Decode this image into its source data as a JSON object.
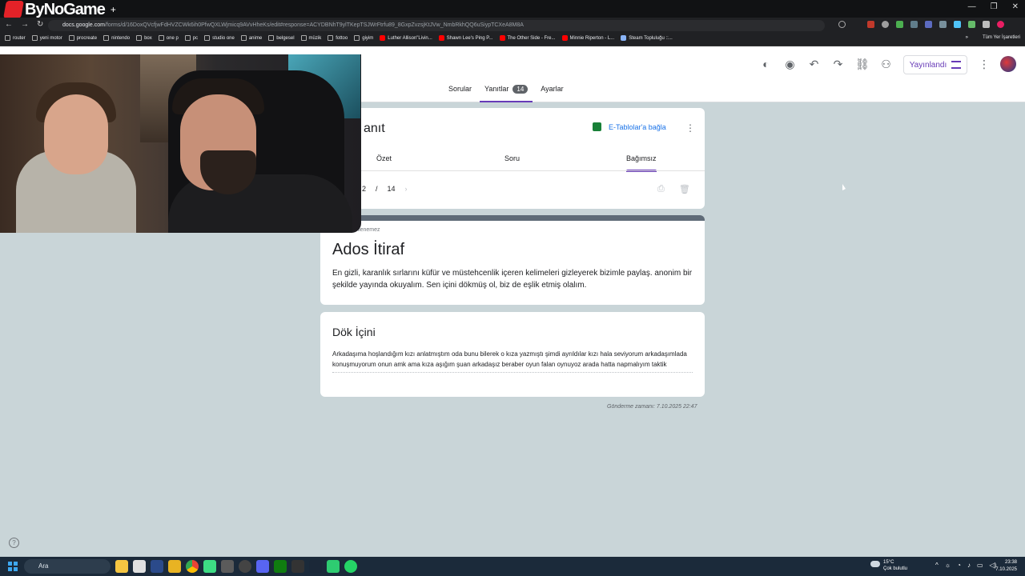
{
  "brand": {
    "logo_text": "ByNoGame"
  },
  "browser": {
    "url_host": "docs.google.com",
    "url_path": "/forms/d/16DoxQVcfjwFdHVZCWk6ih0PfwQXLWjmicq9AVvHheKs/edit#response=ACYDBNhT9ylTKepTSJWrFtrfu89_8GxpZvzsjKtJVw_NmbRkhQQ6uSiypTCXeA8M8A",
    "bookmarks": [
      {
        "label": "router",
        "kind": "folder"
      },
      {
        "label": "yeni motor",
        "kind": "folder"
      },
      {
        "label": "procreate",
        "kind": "folder"
      },
      {
        "label": "nintendo",
        "kind": "folder"
      },
      {
        "label": "box",
        "kind": "folder"
      },
      {
        "label": "one p",
        "kind": "folder"
      },
      {
        "label": "pc",
        "kind": "folder"
      },
      {
        "label": "studio one",
        "kind": "folder"
      },
      {
        "label": "anime",
        "kind": "folder"
      },
      {
        "label": "belgesel",
        "kind": "folder"
      },
      {
        "label": "müzik",
        "kind": "folder"
      },
      {
        "label": "fottoo",
        "kind": "folder"
      },
      {
        "label": "giyim",
        "kind": "folder"
      },
      {
        "label": "Luther Allison\"Livin...",
        "kind": "yt"
      },
      {
        "label": "Shawn Lee's Ping P...",
        "kind": "yt"
      },
      {
        "label": "The Other Side - Fre...",
        "kind": "yt"
      },
      {
        "label": "Minnie Riperton - L...",
        "kind": "yt"
      },
      {
        "label": "Steam Topluluğu ::...",
        "kind": "steam"
      }
    ],
    "bookmarks_more": "»",
    "all_bookmarks": "Tüm Yer İşaretleri"
  },
  "forms": {
    "publish_label": "Yayınlandı",
    "tabs": [
      {
        "label": "Sorular"
      },
      {
        "label": "Yanıtlar",
        "badge": "14"
      },
      {
        "label": "Ayarlar"
      }
    ],
    "response_card": {
      "title": "anıt",
      "sheets_link": "E-Tablolar'a bağla",
      "subtabs": [
        "Özet",
        "Soru",
        "Bağımsız"
      ],
      "pager_current": "2",
      "pager_sep": "/",
      "pager_total": "14"
    },
    "form": {
      "locked_note": "...ar düzenlenemez",
      "title": "Ados İtiraf",
      "description": "En gizli, karanlık sırlarını küfür ve müstehcenlik içeren kelimeleri gizleyerek bizimle paylaş. anonim bir şekilde yayında okuyalım. Sen içini dökmüş ol, biz de eşlik etmiş olalım."
    },
    "question": {
      "title": "Dök İçini",
      "answer": "Arkadaşıma hoşlandığım kızı anlatmıştım oda bunu bilerek o kıza yazmıştı şimdi ayrıldılar kızı hala seviyorum arkadaşımlada konuşmuyorum onun amk ama kıza aşığım şuan arkadaşız beraber oyun falan oynuyoz arada hatta napmalıyım taktik"
    },
    "submitted": "Gönderme zamanı: 7.10.2025 22:47"
  },
  "taskbar": {
    "search_label": "Ara",
    "weather_temp": "15°C",
    "weather_desc": "Çok bulutlu",
    "time": "23:38",
    "date": "7.10.2025"
  },
  "colors": {
    "accent": "#673ab7",
    "sheets_green": "#188038",
    "link_blue": "#1a73e8",
    "page_bg": "#c9d5d8"
  }
}
